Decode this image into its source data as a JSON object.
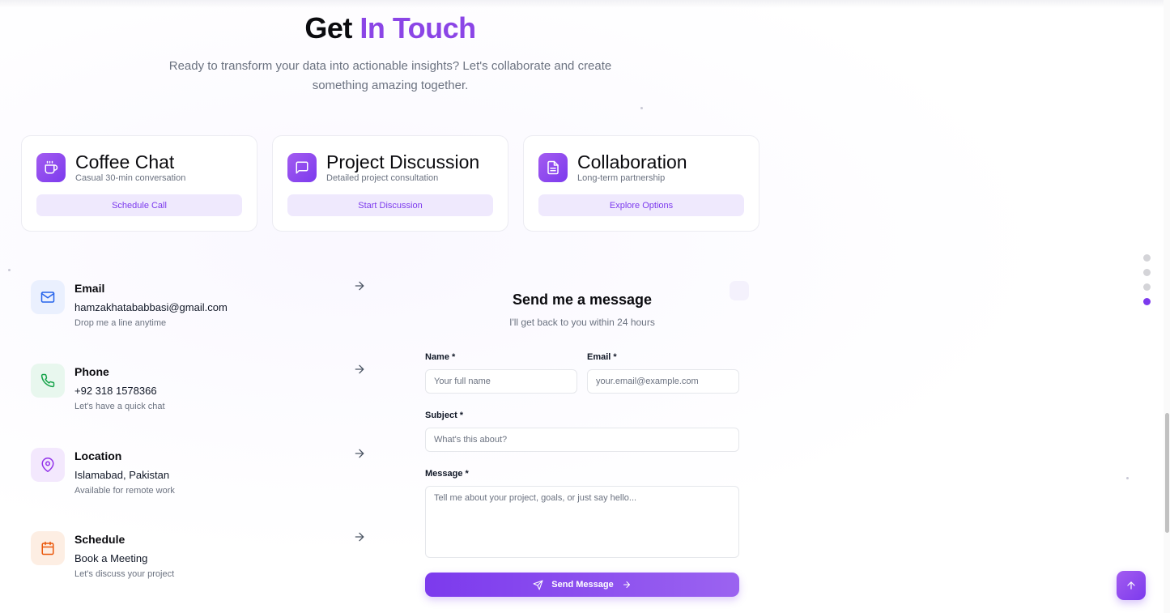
{
  "heading": {
    "prefix": "Get ",
    "accent": "In Touch"
  },
  "subtitle": "Ready to transform your data into actionable insights? Let's collaborate and create something amazing together.",
  "cards": [
    {
      "icon": "coffee-icon",
      "title": "Coffee Chat",
      "desc": "Casual 30-min conversation",
      "button": "Schedule Call"
    },
    {
      "icon": "message-icon",
      "title": "Project Discussion",
      "desc": "Detailed project consultation",
      "button": "Start Discussion"
    },
    {
      "icon": "document-icon",
      "title": "Collaboration",
      "desc": "Long-term partnership",
      "button": "Explore Options"
    }
  ],
  "contacts": [
    {
      "icon": "mail-icon",
      "label": "Email",
      "value": "hamzakhatababbasi@gmail.com",
      "note": "Drop me a line anytime",
      "color": "#2563eb",
      "bg": "#eaf0fe"
    },
    {
      "icon": "phone-icon",
      "label": "Phone",
      "value": "+92 318 1578366",
      "note": "Let's have a quick chat",
      "color": "#16a34a",
      "bg": "#e8f7ee"
    },
    {
      "icon": "location-pin-icon",
      "label": "Location",
      "value": "Islamabad, Pakistan",
      "note": "Available for remote work",
      "color": "#9333ea",
      "bg": "#f3e8fd"
    },
    {
      "icon": "calendar-icon",
      "label": "Schedule",
      "value": "Book a Meeting",
      "note": "Let's discuss your project",
      "color": "#ea580c",
      "bg": "#fdeee3"
    }
  ],
  "form": {
    "title": "Send me a message",
    "subtitle": "I'll get back to you within 24 hours",
    "name_label": "Name *",
    "name_placeholder": "Your full name",
    "email_label": "Email *",
    "email_placeholder": "your.email@example.com",
    "subject_label": "Subject *",
    "subject_placeholder": "What's this about?",
    "message_label": "Message *",
    "message_placeholder": "Tell me about your project, goals, or just say hello...",
    "submit_label": "Send Message"
  },
  "section_nav": {
    "count": 4,
    "active_index": 3
  },
  "colors": {
    "accent": "#7c3aed",
    "accent_light": "#8b45e6",
    "button_bg": "#efe9fd"
  }
}
